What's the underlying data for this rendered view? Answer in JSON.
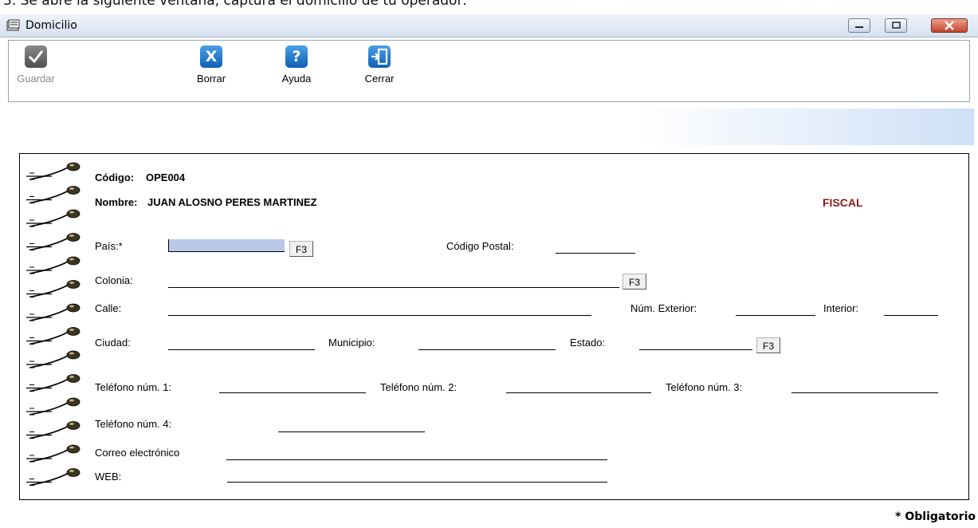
{
  "caption": "3. Se abre la siguiente ventana, captura el domicilio de tu operador:",
  "window": {
    "title": "Domicilio"
  },
  "toolbar": {
    "guardar": "Guardar",
    "borrar": "Borrar",
    "ayuda": "Ayuda",
    "cerrar": "Cerrar"
  },
  "icons": {
    "guardar": "check-icon",
    "borrar": "x-icon",
    "ayuda": "question-icon",
    "cerrar": "exit-door-icon"
  },
  "header": {
    "codigo_label": "Código:",
    "codigo_value": "OPE004",
    "nombre_label": "Nombre:",
    "nombre_value": "JUAN ALOSNO PERES MARTINEZ",
    "tipo": "FISCAL"
  },
  "form": {
    "pais": "País:*",
    "codigo_postal": "Código Postal:",
    "colonia": "Colonia:",
    "calle": "Calle:",
    "num_exterior": "Núm. Exterior:",
    "interior": "Interior:",
    "ciudad": "Ciudad:",
    "municipio": "Municipio:",
    "estado": "Estado:",
    "tel1": "Teléfono núm. 1:",
    "tel2": "Teléfono núm. 2:",
    "tel3": "Teléfono núm. 3:",
    "tel4": "Teléfono núm. 4:",
    "correo": "Correo electrónico",
    "web": "WEB:",
    "f3": "F3"
  },
  "footer": {
    "obligatorio": "* Obligatorio"
  },
  "colors": {
    "accent_blue": "#0f5fb5",
    "fiscal": "#8b1a1a",
    "input_fill": "#b9c9ea"
  }
}
